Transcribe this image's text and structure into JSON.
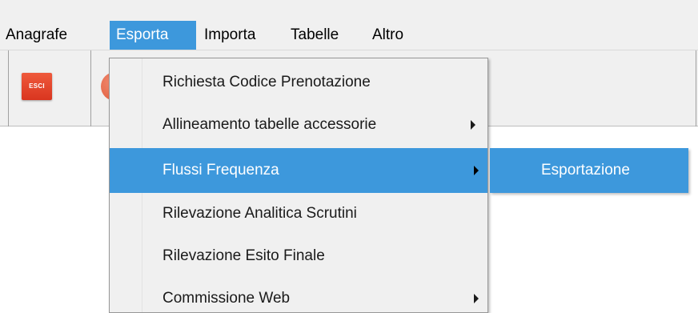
{
  "menubar": {
    "items": [
      {
        "label": "Anagrafe"
      },
      {
        "label": "Esporta"
      },
      {
        "label": "Importa"
      },
      {
        "label": "Tabelle"
      },
      {
        "label": "Altro"
      }
    ],
    "active_item": "Esporta"
  },
  "toolbar": {
    "exit_label": "ESCI"
  },
  "dropdown": {
    "items": [
      {
        "label": "Richiesta Codice Prenotazione",
        "has_submenu": false
      },
      {
        "label": "Allineamento tabelle accessorie",
        "has_submenu": true
      },
      {
        "label": "Flussi Frequenza",
        "has_submenu": true,
        "highlighted": true
      },
      {
        "label": "Rilevazione Analitica Scrutini",
        "has_submenu": false
      },
      {
        "label": "Rilevazione Esito Finale",
        "has_submenu": false
      },
      {
        "label": "Commissione Web",
        "has_submenu": true
      }
    ]
  },
  "submenu": {
    "items": [
      {
        "label": "Esportazione"
      }
    ]
  },
  "colors": {
    "highlight": "#3d98dc",
    "menubar_bg": "#f0f0f0",
    "exit_button": "#e0452a"
  }
}
